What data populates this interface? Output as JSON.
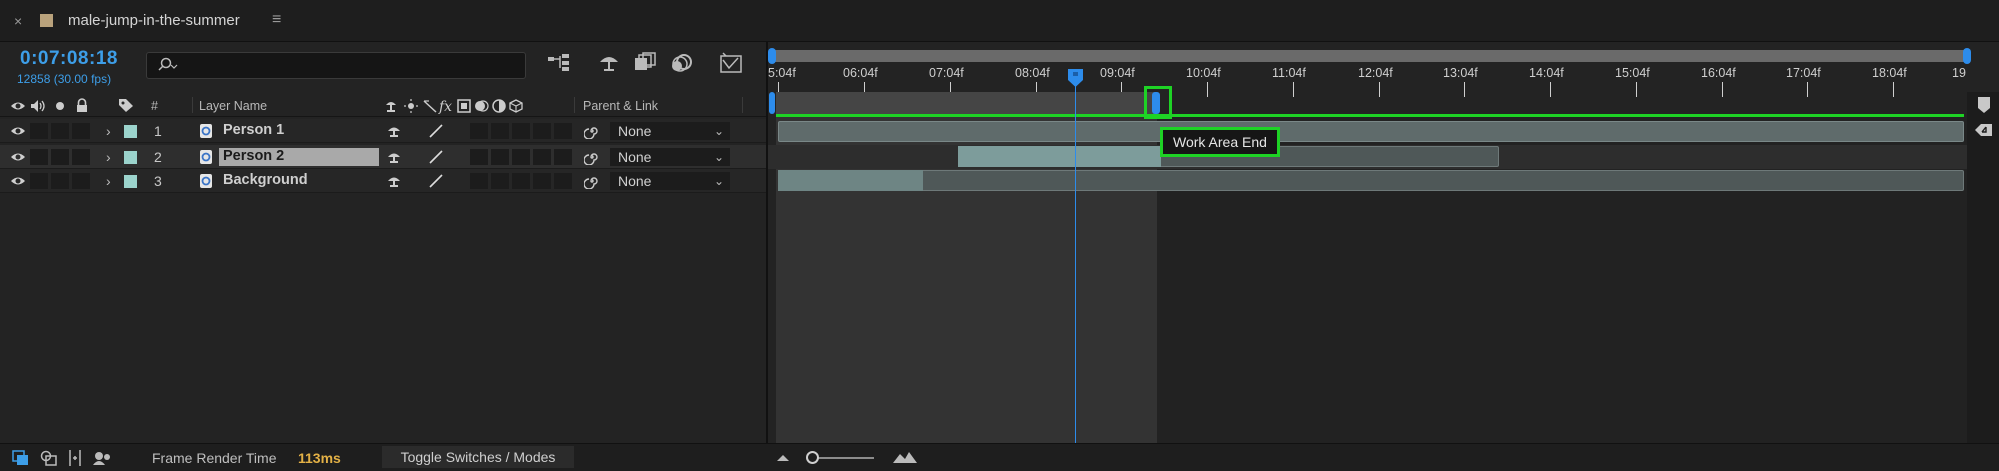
{
  "panel": {
    "close_glyph": "×",
    "comp_name": "male-jump-in-the-summer",
    "menu_glyph": "≡",
    "swatch_color": "#b9a27c"
  },
  "header": {
    "timecode": "0:07:08:18",
    "frame_info": "12858 (30.00 fps)",
    "search_placeholder": ""
  },
  "columns": {
    "number": "#",
    "layer_name": "Layer Name",
    "parent_link": "Parent & Link"
  },
  "layers": [
    {
      "number": "1",
      "name": "Person 1",
      "parent": "None",
      "selected": false
    },
    {
      "number": "2",
      "name": "Person 2",
      "parent": "None",
      "selected": true
    },
    {
      "number": "3",
      "name": "Background",
      "parent": "None",
      "selected": false
    }
  ],
  "ruler": {
    "ticks": [
      "5:04f",
      "06:04f",
      "07:04f",
      "08:04f",
      "09:04f",
      "10:04f",
      "11:04f",
      "12:04f",
      "13:04f",
      "14:04f",
      "15:04f",
      "16:04f",
      "17:04f",
      "18:04f",
      "19"
    ]
  },
  "tooltip": {
    "text": "Work Area End"
  },
  "footer": {
    "frame_render_label": "Frame Render Time",
    "frame_render_value": "113ms",
    "toggle_label": "Toggle Switches / Modes"
  },
  "colors": {
    "accent_blue": "#2d8ceb",
    "highlight_green": "#1ed325",
    "label_teal": "#9bd3cc",
    "render_time": "#e3b146"
  }
}
